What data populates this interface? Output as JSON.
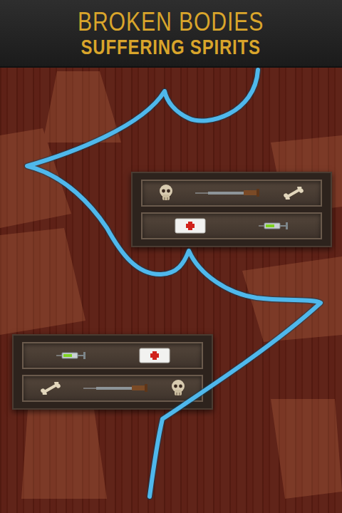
{
  "header": {
    "title": "BROKEN BODIES",
    "subtitle": "SUFFERING SPIRITS"
  },
  "coffins": [
    {
      "compartments": [
        {
          "items": [
            {
              "kind": "skull"
            },
            {
              "kind": "long-syringe"
            },
            {
              "kind": "bone"
            }
          ]
        },
        {
          "items": [
            {
              "kind": "bandage"
            },
            {
              "kind": "green-syringe"
            }
          ]
        }
      ]
    },
    {
      "compartments": [
        {
          "items": [
            {
              "kind": "green-syringe"
            },
            {
              "kind": "bandage"
            }
          ]
        },
        {
          "items": [
            {
              "kind": "bone"
            },
            {
              "kind": "long-syringe"
            },
            {
              "kind": "skull"
            }
          ]
        }
      ]
    }
  ]
}
